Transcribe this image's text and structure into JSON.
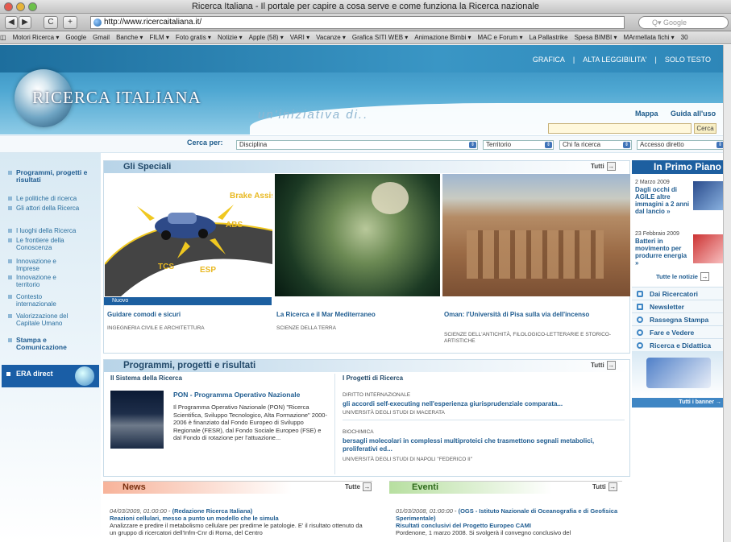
{
  "window": {
    "title": "Ricerca Italiana - Il portale per capire a cosa serve e come funziona la Ricerca nazionale"
  },
  "browser": {
    "back": "◀",
    "forward": "▶",
    "reload": "C",
    "add": "+",
    "url": "http://www.ricercaitaliana.it/",
    "search_placeholder": "Q▾ Google",
    "bookmarks": [
      "◫",
      "Motori Ricerca ▾",
      "Google",
      "Gmail",
      "Banche ▾",
      "FILM ▾",
      "Foto gratis ▾",
      "Notizie ▾",
      "Apple (58) ▾",
      "VARI ▾",
      "Vacanze ▾",
      "Grafica SITI WEB ▾",
      "Animazione Bimbi ▾",
      "MAC e Forum ▾",
      "La Pallastrike",
      "Spesa BIMBI ▾",
      "MArmellata fichi ▾",
      "30"
    ]
  },
  "header": {
    "links": [
      "GRAFICA",
      "|",
      "ALTA LEGGIBILITA'",
      "|",
      "SOLO TESTO"
    ],
    "logo_text": "RICERCA ITALIANA",
    "tagline": "un'iniziativa di..",
    "mappa": "Mappa",
    "guida": "Guida all'uso",
    "cerca_btn": "Cerca"
  },
  "filters": {
    "label": "Cerca per:",
    "disciplina": "Disciplina",
    "territorio": "Territorio",
    "chi": "Chi fa ricerca",
    "accesso": "Accesso diretto"
  },
  "nav": [
    {
      "label": "Programmi, progetti e risultati",
      "strong": true
    },
    {
      "label": "Le politiche di ricerca"
    },
    {
      "label": "Gli attori della Ricerca"
    },
    {
      "label": "I luoghi della Ricerca"
    },
    {
      "label": "Le frontiere della Conoscenza"
    },
    {
      "label": "Innovazione e Imprese"
    },
    {
      "label": "Innovazione e territorio"
    },
    {
      "label": "Contesto internazionale"
    },
    {
      "label": "Valorizzazione del Capitale Umano"
    },
    {
      "label": "Stampa e Comunicazione",
      "strong": true
    }
  ],
  "era": "ERA direct",
  "speciali": {
    "title": "Gli Speciali",
    "tutti": "Tutti",
    "nuovo": "Nuovo",
    "cards": [
      {
        "title": "Guidare comodi e sicuri",
        "sub": "INGEGNERIA CIVILE E ARCHITETTURA"
      },
      {
        "title": "La Ricerca e il Mar Mediterraneo",
        "sub": "SCIENZE DELLA TERRA"
      },
      {
        "title": "Oman: l'Università di Pisa sulla via dell'incenso",
        "sub": "SCIENZE DELL'ANTICHITÀ, FILOLOGICO-LETTERARIE E STORICO-ARTISTICHE"
      }
    ],
    "car_labels": [
      "Brake Assist",
      "ABS",
      "TCS",
      "ESP"
    ]
  },
  "programmi": {
    "title": "Programmi, progetti e risultati",
    "tutti": "Tutti",
    "left_head": "Il Sistema della Ricerca",
    "right_head": "I Progetti di Ricerca",
    "pon_title": "PON - Programma Operativo Nazionale",
    "pon_text": "Il Programma Operativo Nazionale (PON) \"Ricerca Scientifica, Sviluppo Tecnologico, Alta Formazione\" 2000-2006 è finanziato dal Fondo Europeo di Sviluppo Regionale (FESR), dal Fondo Sociale Europeo (FSE) e dal Fondo di rotazione per l'attuazione...",
    "projects": [
      {
        "cat": "DIRITTO INTERNAZIONALE",
        "title": "gli accordi self-executing nell'esperienza giurisprudenziale comparata...",
        "uni": "UNIVERSITÀ DEGLI STUDI DI MACERATA"
      },
      {
        "cat": "BIOCHIMICA",
        "title": "bersagli molecolari in complessi multiproteici che trasmettono segnali metabolici, proliferativi ed...",
        "uni": "UNIVERSITÀ DEGLI STUDI DI NAPOLI \"FEDERICO II\""
      }
    ]
  },
  "news": {
    "title": "News",
    "tutte": "Tutte",
    "date": "04/03/2009, 01:00:00",
    "source": "(Redazione Ricerca Italiana)",
    "headline": "Reazioni cellulari, messo a punto un modello che le simula",
    "text": "Analizzare e predire il metabolismo cellulare per predirne le patologie. E' il risultato ottenuto da un gruppo di ricercatori dell'Infm-Cnr di Roma, del Centro"
  },
  "eventi": {
    "title": "Eventi",
    "tutti": "Tutti",
    "date": "01/03/2008, 01:00:00",
    "source": "(OGS - Istituto Nazionale di Oceanografia e di Geofisica Sperimentale)",
    "headline": "Risultati conclusivi del Progetto Europeo CAMI",
    "text": "Pordenone, 1 marzo 2008. Si svolgerà il convegno conclusivo del"
  },
  "primo_piano": {
    "title": "In Primo Piano",
    "items": [
      {
        "date": "2 Marzo 2009",
        "title": "Dagli occhi di AGILE altre immagini a 2 anni dal lancio »"
      },
      {
        "date": "23 Febbraio 2009",
        "title": "Batteri in movimento per produrre energia »"
      }
    ],
    "tutte": "Tutte le notizie",
    "links": [
      "Dai Ricercatori",
      "Newsletter",
      "Rassegna Stampa",
      "Fare e Vedere",
      "Ricerca e Didattica"
    ],
    "tutti_banner": "Tutti i banner"
  },
  "colors": {
    "brand": "#1d5fa0",
    "header": "#3a96c5"
  }
}
